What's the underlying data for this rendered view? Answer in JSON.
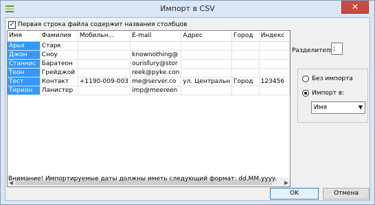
{
  "window": {
    "title": "Импорт в CSV",
    "close_glyph": "✕"
  },
  "options": {
    "first_row_headers_label": "Первая строка файла содержит названия столбцов",
    "first_row_headers_checked": true,
    "separator_label": "Разделитель",
    "separator_value": ";"
  },
  "grid": {
    "columns": [
      "Имя",
      "Фамилия",
      "Мобильн...",
      "E-mail",
      "Адрес",
      "Город",
      "Индекс"
    ],
    "rows": [
      [
        "Арья",
        "Старк",
        "",
        "",
        "",
        "",
        ""
      ],
      [
        "Джон",
        "Сноу",
        "",
        "knownothing@",
        "",
        "",
        ""
      ],
      [
        "Станнис",
        "Баратеон",
        "",
        "ourisfury@stor",
        "",
        "",
        ""
      ],
      [
        "Теон",
        "Грейджой",
        "",
        "reek@pyke.con",
        "",
        "",
        ""
      ],
      [
        "Тест",
        "Контакт",
        "+1190-009-003",
        "me@server.co",
        "ул. Центральн",
        "Город",
        "123456"
      ],
      [
        "Тирион",
        "Ланистер",
        "",
        "imp@meereen",
        "",
        "",
        ""
      ]
    ]
  },
  "import_mode": {
    "no_import_label": "Без импорта",
    "import_to_label": "Импорт в:",
    "selected": "import_to",
    "target_value": "Имя"
  },
  "status": {
    "date_format_note": "Внимание! Импортируемые даты должны иметь следующий формат: dd.MM.yyyy."
  },
  "buttons": {
    "ok_label": "OK",
    "cancel_label": "Отмена"
  }
}
